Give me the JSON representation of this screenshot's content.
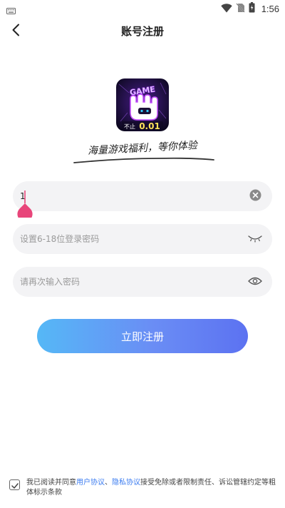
{
  "status": {
    "time": "1:56",
    "icons": [
      "keyboard-icon",
      "wifi-icon",
      "no-sim-icon",
      "battery-icon"
    ]
  },
  "header": {
    "title": "账号注册",
    "back_icon": "chevron-left-icon"
  },
  "app_logo": {
    "game_text": "GAME",
    "badge_prefix": "不止",
    "badge_value": "0.01"
  },
  "slogan": "海量游戏福利，等你体验",
  "form": {
    "account": {
      "value": "1",
      "clear_icon": "clear-icon"
    },
    "password": {
      "placeholder": "设置6-18位登录密码",
      "toggle_icon": "eye-closed-icon"
    },
    "confirm": {
      "placeholder": "请再次输入密码",
      "toggle_icon": "eye-open-icon"
    },
    "submit_label": "立即注册"
  },
  "agreement": {
    "checked": true,
    "prefix": "我已阅读并同意",
    "link_user": "用户协议",
    "separator": "、",
    "link_privacy": "隐私协议",
    "suffix": "接受免除或者限制责任、诉讼管辖约定等粗体标示条款"
  },
  "colors": {
    "accent": "#3a7bf0",
    "button_start": "#55b8f6",
    "button_end": "#5c72f1",
    "cursor": "#e8457a",
    "field_bg": "#f3f3f5"
  }
}
